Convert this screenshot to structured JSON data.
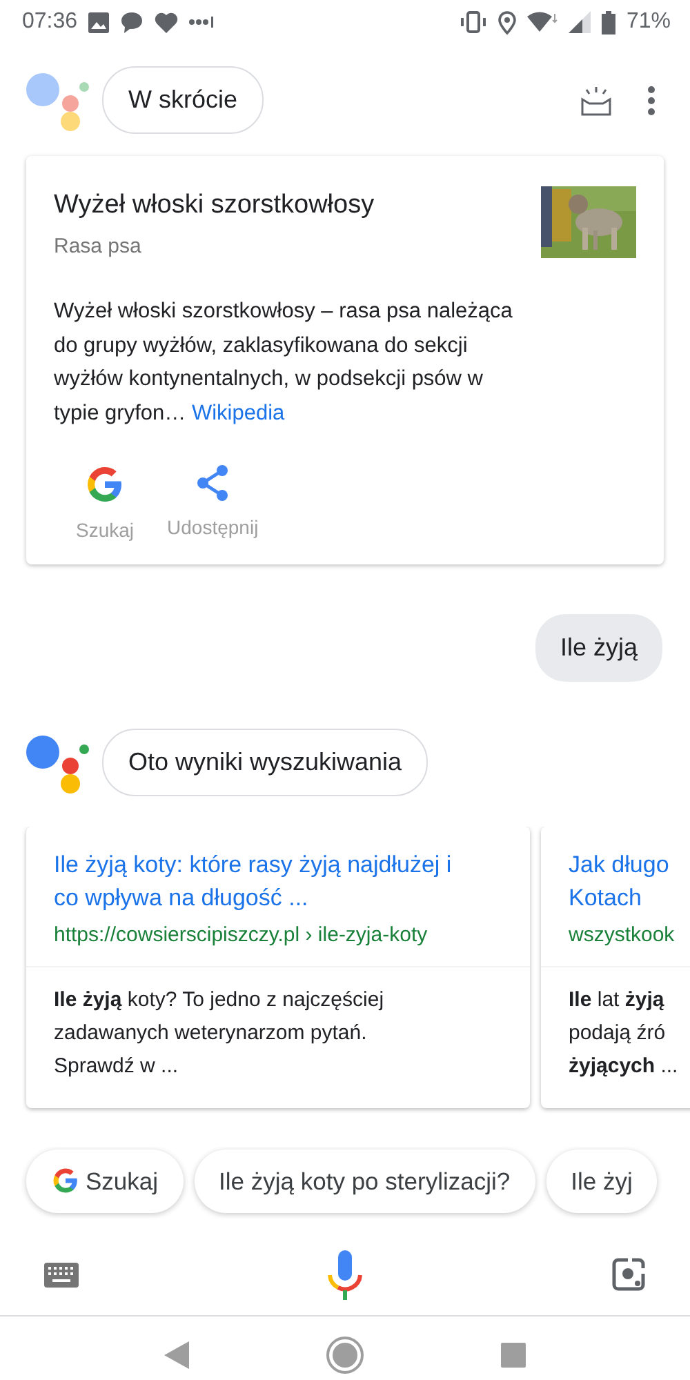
{
  "status_bar": {
    "time": "07:36",
    "battery": "71%"
  },
  "header": {
    "chip": "W skrócie"
  },
  "knowledge_card": {
    "title": "Wyżeł włoski szorstkowłosy",
    "subtitle": "Rasa psa",
    "description": "Wyżeł włoski szorstkowłosy – rasa psa należąca do grupy wyżłów, zaklasyfikowana do sekcji wyżłów kontynentalnych, w podsekcji psów w typie gryfon…",
    "source_link": "Wikipedia",
    "actions": [
      {
        "kind": "google",
        "label": "Szukaj"
      },
      {
        "kind": "share",
        "label": "Udostępnij"
      }
    ]
  },
  "user_query": "Ile żyją",
  "assistant_reply": {
    "chip": "Oto wyniki wyszukiwania"
  },
  "results": [
    {
      "title_lines": [
        "Ile żyją koty: które rasy żyją najdłużej i",
        "co wpływa na długość ..."
      ],
      "url": "https://cowsierscipiszczy.pl › ile-zyja-koty",
      "snippet_lines": [
        "**Ile żyją** koty? To jedno z najczęściej",
        "zadawanych weterynarzom pytań.",
        "Sprawdź w ..."
      ]
    },
    {
      "title_lines": [
        "Jak długo",
        "Kotach"
      ],
      "url": "wszystkook",
      "snippet_lines": [
        "**Ile** lat **żyją**",
        "podają źró",
        "**żyjących** ..."
      ]
    }
  ],
  "suggestions": [
    {
      "kind": "google",
      "label": "Szukaj"
    },
    {
      "kind": "text",
      "label": "Ile żyją koty po sterylizacji?"
    },
    {
      "kind": "text",
      "label": "Ile żyj"
    }
  ]
}
